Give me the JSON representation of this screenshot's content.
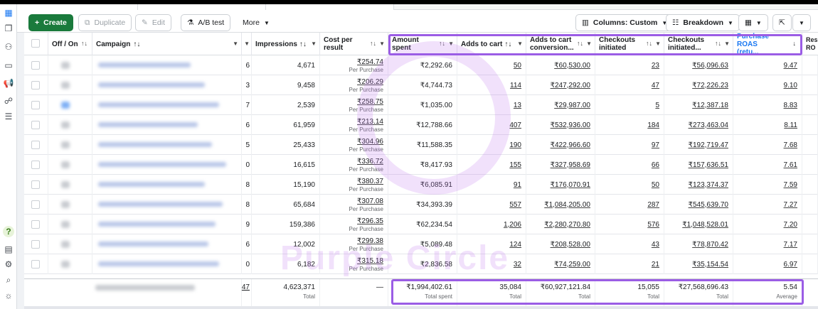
{
  "toolbar": {
    "create": "Create",
    "duplicate": "Duplicate",
    "edit": "Edit",
    "ab_test": "A/B test",
    "more": "More",
    "columns": "Columns: Custom",
    "breakdown": "Breakdown"
  },
  "columns": {
    "off_on": "Off / On",
    "campaign": "Campaign",
    "impressions": "Impressions",
    "cost_per_result": "Cost per result",
    "amount_spent": "Amount spent",
    "adds_to_cart": "Adds to cart",
    "adds_to_cart_value": "Adds to cart conversion...",
    "checkouts": "Checkouts initiated",
    "checkouts_value": "Checkouts initiated...",
    "purchase_roas": "Purchase ROAS (retu...",
    "next": "Res RO"
  },
  "rows": [
    {
      "prev": "6",
      "impressions": "4,671",
      "cpr": "₹254.74",
      "cpr_sub": "Per Purchase",
      "spent": "₹2,292.66",
      "atc": "50",
      "atc_value": "₹60,530.00",
      "chk": "23",
      "chk_value": "₹56,096.63",
      "roas": "9.47"
    },
    {
      "prev": "3",
      "impressions": "9,458",
      "cpr": "₹206.29",
      "cpr_sub": "Per Purchase",
      "spent": "₹4,744.73",
      "atc": "114",
      "atc_value": "₹247,292.00",
      "chk": "47",
      "chk_value": "₹72,226.23",
      "roas": "9.10"
    },
    {
      "prev": "7",
      "impressions": "2,539",
      "cpr": "₹258.75",
      "cpr_sub": "Per Purchase",
      "spent": "₹1,035.00",
      "atc": "13",
      "atc_value": "₹29,987.00",
      "chk": "5",
      "chk_value": "₹12,387.18",
      "roas": "8.83"
    },
    {
      "prev": "6",
      "impressions": "61,959",
      "cpr": "₹213.14",
      "cpr_sub": "Per Purchase",
      "spent": "₹12,788.66",
      "atc": "407",
      "atc_value": "₹532,936.00",
      "chk": "184",
      "chk_value": "₹273,463.04",
      "roas": "8.11"
    },
    {
      "prev": "5",
      "impressions": "25,433",
      "cpr": "₹304.96",
      "cpr_sub": "Per Purchase",
      "spent": "₹11,588.35",
      "atc": "190",
      "atc_value": "₹422,966.60",
      "chk": "97",
      "chk_value": "₹192,719.47",
      "roas": "7.68"
    },
    {
      "prev": "0",
      "impressions": "16,615",
      "cpr": "₹336.72",
      "cpr_sub": "Per Purchase",
      "spent": "₹8,417.93",
      "atc": "155",
      "atc_value": "₹327,958.69",
      "chk": "66",
      "chk_value": "₹157,636.51",
      "roas": "7.61"
    },
    {
      "prev": "8",
      "impressions": "15,190",
      "cpr": "₹380.37",
      "cpr_sub": "Per Purchase",
      "spent": "₹6,085.91",
      "atc": "91",
      "atc_value": "₹176,070.91",
      "chk": "50",
      "chk_value": "₹123,374.37",
      "roas": "7.59"
    },
    {
      "prev": "8",
      "impressions": "65,684",
      "cpr": "₹307.08",
      "cpr_sub": "Per Purchase",
      "spent": "₹34,393.39",
      "atc": "557",
      "atc_value": "₹1,084,205.00",
      "chk": "287",
      "chk_value": "₹545,639.70",
      "roas": "7.27"
    },
    {
      "prev": "9",
      "impressions": "159,386",
      "cpr": "₹296.35",
      "cpr_sub": "Per Purchase",
      "spent": "₹62,234.54",
      "atc": "1,206",
      "atc_value": "₹2,280,270.80",
      "chk": "576",
      "chk_value": "₹1,048,528.01",
      "roas": "7.20"
    },
    {
      "prev": "6",
      "impressions": "12,002",
      "cpr": "₹299.38",
      "cpr_sub": "Per Purchase",
      "spent": "₹5,089.48",
      "atc": "124",
      "atc_value": "₹208,528.00",
      "chk": "43",
      "chk_value": "₹78,870.42",
      "roas": "7.17"
    },
    {
      "prev": "0",
      "impressions": "6,182",
      "cpr": "₹315.18",
      "cpr_sub": "Per Purchase",
      "spent": "₹2,836.58",
      "atc": "32",
      "atc_value": "₹74,259.00",
      "chk": "21",
      "chk_value": "₹35,154.54",
      "roas": "6.97"
    }
  ],
  "totals": {
    "prev": "47",
    "impressions": "4,623,371",
    "impressions_sub": "Total",
    "cpr": "—",
    "spent": "₹1,994,402.61",
    "spent_sub": "Total spent",
    "atc": "35,084",
    "atc_sub": "Total",
    "atc_value": "₹60,927,121.84",
    "atc_value_sub": "Total",
    "chk": "15,055",
    "chk_sub": "Total",
    "chk_value": "₹27,568,696.43",
    "chk_value_sub": "Total",
    "roas": "5.54",
    "roas_sub": "Average"
  },
  "watermark": "Purple Circle",
  "colors": {
    "create": "#1a7a3c",
    "highlight": "#9b5de5",
    "link": "#1877f2"
  },
  "rail_icons": [
    "table-grid-icon",
    "pages-icon",
    "audience-icon",
    "billing-icon",
    "megaphone-icon",
    "people-icon",
    "menu-icon",
    "help-icon",
    "report-icon",
    "settings-icon",
    "search-icon",
    "bug-icon"
  ]
}
